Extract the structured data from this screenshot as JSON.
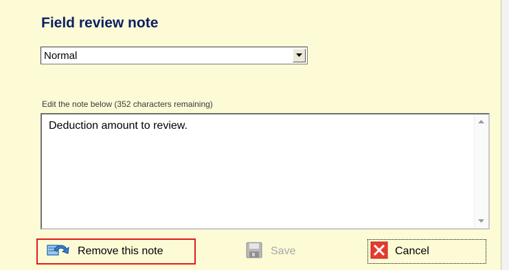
{
  "dialog": {
    "title": "Field review note",
    "note_type_select": {
      "selected": "Normal"
    },
    "hint": "Edit the note below (352 characters remaining)",
    "note_text": "Deduction amount to review.",
    "buttons": {
      "remove_label": "Remove this note",
      "save_label": "Save",
      "cancel_label": "Cancel"
    }
  },
  "colors": {
    "panel_background": "#fdfbd6",
    "title": "#0d1f63",
    "remove_highlight": "#e01a1a",
    "cancel_icon": "#e53b2f",
    "disabled_text": "#a8a8a8"
  },
  "icons": {
    "remove": "note-remove-icon",
    "save": "floppy-disk-icon",
    "cancel": "red-x-icon",
    "dropdown": "dropdown-arrow-icon"
  }
}
